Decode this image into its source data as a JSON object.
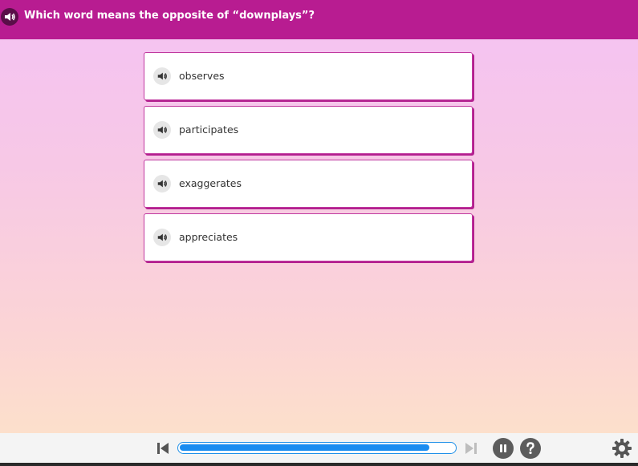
{
  "question": {
    "text": "Which word means the opposite of “downplays”?",
    "speaker_icon": "speaker-icon"
  },
  "answers": [
    {
      "label": "observes",
      "icon": "speaker-icon"
    },
    {
      "label": "participates",
      "icon": "speaker-icon"
    },
    {
      "label": "exaggerates",
      "icon": "speaker-icon"
    },
    {
      "label": "appreciates",
      "icon": "speaker-icon"
    }
  ],
  "footer": {
    "progress": 0.91,
    "buttons": [
      "skip-back-icon",
      "skip-forward-icon",
      "pause-icon",
      "help-icon",
      "gear-icon"
    ]
  },
  "colors": {
    "header_bg": "#b81c91",
    "accent": "#b3208f",
    "progress": "#1a8cf0"
  }
}
